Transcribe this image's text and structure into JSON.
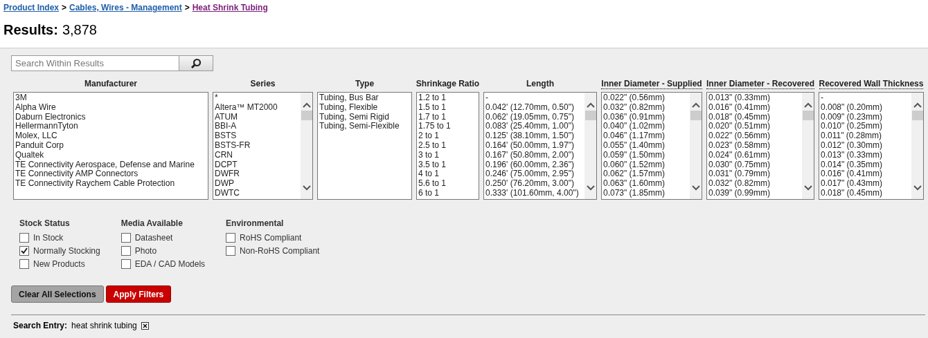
{
  "breadcrumb": [
    {
      "label": "Product Index",
      "visited": false
    },
    {
      "label": "Cables, Wires - Management",
      "visited": false
    },
    {
      "label": "Heat Shrink Tubing",
      "visited": true
    }
  ],
  "breadcrumb_separator": ">",
  "results": {
    "label": "Results:",
    "count": "3,878"
  },
  "search": {
    "placeholder": "Search Within Results"
  },
  "filters": [
    {
      "title": "Manufacturer",
      "underlined": false,
      "scrollbar": false,
      "options": [
        "3M",
        "Alpha Wire",
        "Daburn Electronics",
        "HellermannTyton",
        "Molex, LLC",
        "Panduit Corp",
        "Qualtek",
        "TE Connectivity Aerospace, Defense and Marine",
        "TE Connectivity AMP Connectors",
        "TE Connectivity Raychem Cable Protection"
      ]
    },
    {
      "title": "Series",
      "underlined": false,
      "scrollbar": true,
      "options": [
        "*",
        "Altera™ MT2000",
        "ATUM",
        "BBI-A",
        "BSTS",
        "BSTS-FR",
        "CRN",
        "DCPT",
        "DWFR",
        "DWP",
        "DWTC"
      ]
    },
    {
      "title": "Type",
      "underlined": false,
      "scrollbar": false,
      "options": [
        "Tubing, Bus Bar",
        "Tubing, Flexible",
        "Tubing, Semi Rigid",
        "Tubing, Semi-Flexible"
      ]
    },
    {
      "title": "Shrinkage Ratio",
      "underlined": false,
      "scrollbar": false,
      "options": [
        "1.2 to 1",
        "1.5 to 1",
        "1.7 to 1",
        "1.75 to 1",
        "2 to 1",
        "2.5 to 1",
        "3 to 1",
        "3.5 to 1",
        "4 to 1",
        "5.6 to 1",
        "6 to 1"
      ]
    },
    {
      "title": "Length",
      "underlined": false,
      "scrollbar": true,
      "options": [
        "-",
        "0.042' (12.70mm, 0.50\")",
        "0.062' (19.05mm, 0.75\")",
        "0.083' (25.40mm, 1.00\")",
        "0.125' (38.10mm, 1.50\")",
        "0.164' (50.00mm, 1.97\")",
        "0.167' (50.80mm, 2.00\")",
        "0.196' (60.00mm, 2.36\")",
        "0.246' (75.00mm, 2.95\")",
        "0.250' (76.20mm, 3.00\")",
        "0.333' (101.60mm, 4.00\")"
      ]
    },
    {
      "title": "Inner Diameter - Supplied",
      "underlined": true,
      "scrollbar": true,
      "options": [
        "0.022\" (0.56mm)",
        "0.032\" (0.82mm)",
        "0.036\" (0.91mm)",
        "0.040\" (1.02mm)",
        "0.046\" (1.17mm)",
        "0.055\" (1.40mm)",
        "0.059\" (1.50mm)",
        "0.060\" (1.52mm)",
        "0.062\" (1.57mm)",
        "0.063\" (1.60mm)",
        "0.073\" (1.85mm)"
      ]
    },
    {
      "title": "Inner Diameter - Recovered",
      "underlined": true,
      "scrollbar": true,
      "options": [
        "0.013\" (0.33mm)",
        "0.016\" (0.41mm)",
        "0.018\" (0.45mm)",
        "0.020\" (0.51mm)",
        "0.022\" (0.56mm)",
        "0.023\" (0.58mm)",
        "0.024\" (0.61mm)",
        "0.030\" (0.75mm)",
        "0.031\" (0.79mm)",
        "0.032\" (0.82mm)",
        "0.039\" (0.99mm)"
      ]
    },
    {
      "title": "Recovered Wall Thickness",
      "underlined": true,
      "scrollbar": true,
      "options": [
        "-",
        "0.008\" (0.20mm)",
        "0.009\" (0.23mm)",
        "0.010\" (0.25mm)",
        "0.011\" (0.28mm)",
        "0.012\" (0.30mm)",
        "0.013\" (0.33mm)",
        "0.014\" (0.35mm)",
        "0.016\" (0.41mm)",
        "0.017\" (0.43mm)",
        "0.018\" (0.45mm)"
      ]
    }
  ],
  "checkbox_groups": [
    {
      "title": "Stock Status",
      "items": [
        {
          "label": "In Stock",
          "checked": false
        },
        {
          "label": "Normally Stocking",
          "checked": true
        },
        {
          "label": "New Products",
          "checked": false
        }
      ]
    },
    {
      "title": "Media Available",
      "items": [
        {
          "label": "Datasheet",
          "checked": false
        },
        {
          "label": "Photo",
          "checked": false
        },
        {
          "label": "EDA / CAD Models",
          "checked": false
        }
      ]
    },
    {
      "title": "Environmental",
      "items": [
        {
          "label": "RoHS Compliant",
          "checked": false
        },
        {
          "label": "Non-RoHS Compliant",
          "checked": false
        }
      ]
    }
  ],
  "buttons": [
    {
      "label": "Clear All Selections",
      "kind": "secondary"
    },
    {
      "label": "Apply Filters",
      "kind": "primary"
    }
  ],
  "search_entry": {
    "label": "Search Entry:",
    "value": "heat shrink tubing"
  }
}
